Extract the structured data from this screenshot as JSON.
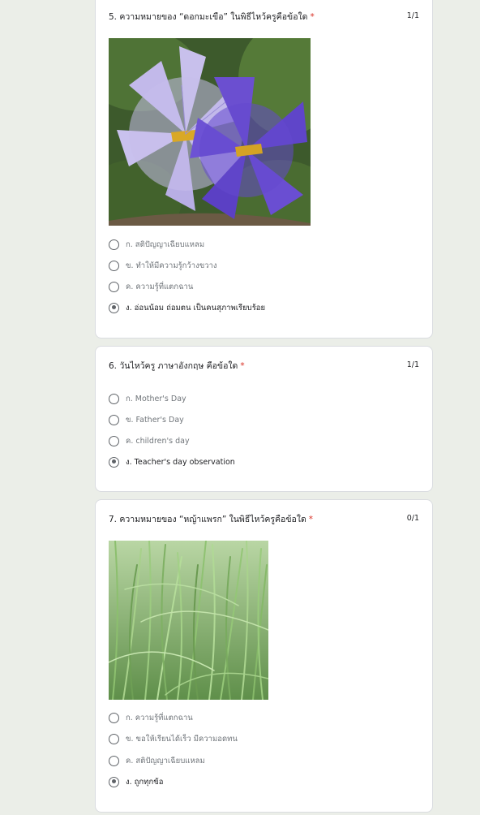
{
  "questions": [
    {
      "number": "5.",
      "title": "ความหมายของ “ดอกมะเขือ” ในพิธีไหว้ครูคือข้อใด",
      "required_mark": "*",
      "score": "1/1",
      "image_icon": "eggplant-flower-image",
      "options": [
        {
          "label": "ก. สติปัญญาเฉียบแหลม",
          "selected": false
        },
        {
          "label": "ข. ทำให้มีความรู้กว้างขวาง",
          "selected": false
        },
        {
          "label": "ค. ความรู้ที่แตกฉาน",
          "selected": false
        },
        {
          "label": "ง. อ่อนน้อม ถ่อมตน เป็นคนสุภาพเรียบร้อย",
          "selected": true
        }
      ]
    },
    {
      "number": "6.",
      "title": "วันไหว้ครู ภาษาอังกฤษ คือข้อใด",
      "required_mark": "*",
      "score": "1/1",
      "options": [
        {
          "label": "ก. Mother's Day",
          "selected": false
        },
        {
          "label": "ข. Father's Day",
          "selected": false
        },
        {
          "label": "ค. children's day",
          "selected": false
        },
        {
          "label": "ง. Teacher's day observation",
          "selected": true
        }
      ]
    },
    {
      "number": "7.",
      "title": "ความหมายของ “หญ้าแพรก” ในพิธีไหว้ครูคือข้อใด",
      "required_mark": "*",
      "score": "0/1",
      "image_icon": "bermuda-grass-image",
      "options": [
        {
          "label": "ก. ความรู้ที่แตกฉาน",
          "selected": false
        },
        {
          "label": "ข. ขอให้เรียนได้เร็ว มีความอดทน",
          "selected": false
        },
        {
          "label": "ค. สติปัญญาเฉียบแหลม",
          "selected": false
        },
        {
          "label": "ง. ถูกทุกข้อ",
          "selected": true
        }
      ]
    }
  ],
  "colors": {
    "background": "#ebeee8",
    "card": "#ffffff",
    "required": "#d93025",
    "radio": "#5f6368"
  }
}
